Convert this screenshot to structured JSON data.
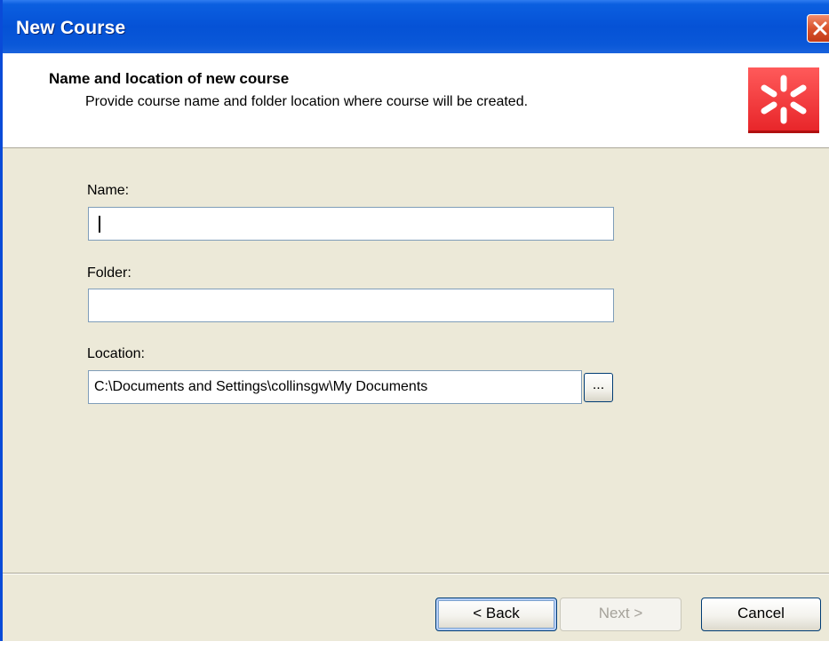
{
  "window": {
    "title": "New Course"
  },
  "header": {
    "title": "Name and location of new course",
    "subtitle": "Provide course name and folder location where course will be created."
  },
  "form": {
    "name_label": "Name:",
    "name_value": "",
    "folder_label": "Folder:",
    "folder_value": "",
    "location_label": "Location:",
    "location_value": "C:\\Documents and Settings\\collinsgw\\My Documents",
    "browse_label": "..."
  },
  "buttons": {
    "back_label": "< Back",
    "next_label": "Next >",
    "cancel_label": "Cancel"
  },
  "icons": {
    "close": "close-icon",
    "logo": "asterisk-logo-icon"
  },
  "colors": {
    "titlebar": "#0552d6",
    "dialog_background": "#ece9d8",
    "logo_red": "#e8262a"
  }
}
